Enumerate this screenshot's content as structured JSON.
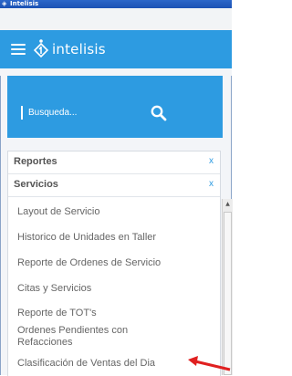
{
  "window": {
    "title": "Intelisis",
    "icon": "diamond-logo-icon"
  },
  "header": {
    "brand": "intelisis",
    "menu_icon": "hamburger-menu-icon",
    "logo_icon": "intelisis-logo-icon",
    "background_color": "#2d9be1"
  },
  "search": {
    "placeholder": "Busqueda...",
    "icon": "search-icon"
  },
  "sections": [
    {
      "label": "Reportes",
      "close_label": "x"
    },
    {
      "label": "Servicios",
      "close_label": "x"
    }
  ],
  "items": [
    {
      "label": "Layout de Servicio"
    },
    {
      "label": "Historico de Unidades en Taller"
    },
    {
      "label": "Reporte de Ordenes de Servicio"
    },
    {
      "label": "Citas y Servicios"
    },
    {
      "label": "Reporte de TOT's"
    },
    {
      "label": "Ordenes Pendientes con Refacciones"
    },
    {
      "label": "Clasificación de Ventas del Dia"
    }
  ],
  "annotation": {
    "arrow_color": "#e02020",
    "arrow_icon": "red-arrow-icon"
  }
}
